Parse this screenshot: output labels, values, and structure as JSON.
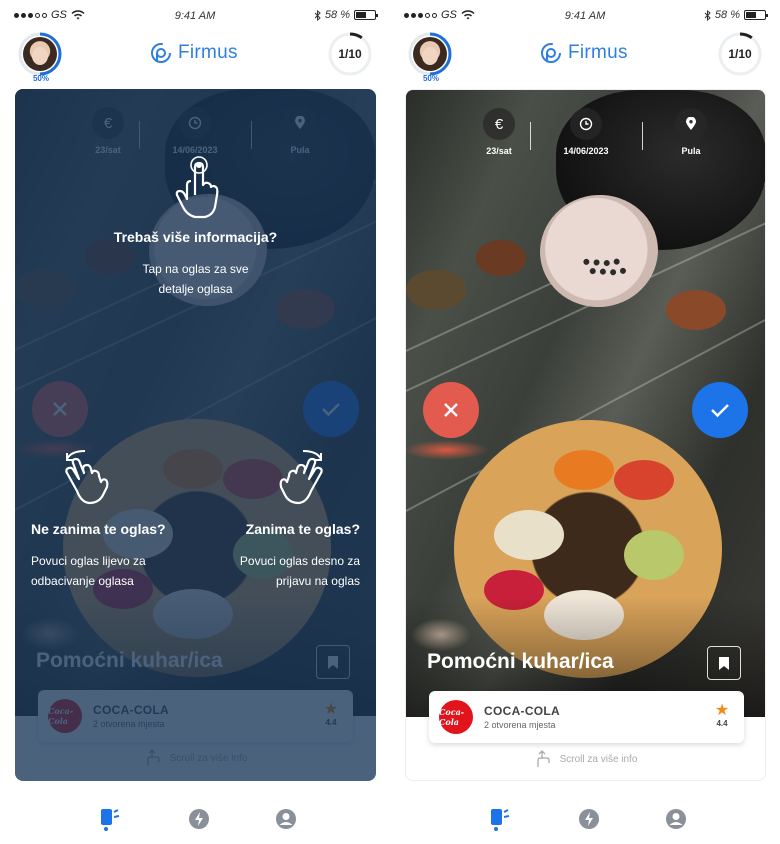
{
  "status_bar": {
    "carrier": "GS",
    "time": "9:41 AM",
    "battery": "58 %",
    "battery_level": 0.58
  },
  "header": {
    "profile_completion": "50%",
    "profile_progress": 0.5,
    "brand": "Firmus",
    "counter": "1/10",
    "counter_progress": 0.1
  },
  "job": {
    "title": "Pomoćni kuhar/ica",
    "meta": [
      {
        "icon": "euro-icon",
        "label": "23/sat"
      },
      {
        "icon": "clock-icon",
        "label": "14/06/2023"
      },
      {
        "icon": "location-pin-icon",
        "label": "Pula"
      }
    ],
    "company": {
      "name": "COCA-COLA",
      "logo_text": "Coca-Cola",
      "openings": "2 otvorena mjesta",
      "rating": "4.4"
    },
    "scroll_hint": "Scroll za više info"
  },
  "tutorial": {
    "tap": {
      "title": "Trebaš više informacija?",
      "line1": "Tap na oglas za sve",
      "line2": "detalje oglasa"
    },
    "left": {
      "title": "Ne zanima te oglas?",
      "line1": "Povuci oglas lijevo za",
      "line2": "odbacivanje oglasa"
    },
    "right": {
      "title": "Zanima te oglas?",
      "line1": "Povuci oglas desno za",
      "line2": "prijavu na oglas"
    }
  },
  "tabbar": [
    {
      "icon": "swipe-cards-icon",
      "active": true
    },
    {
      "icon": "lightning-icon",
      "active": false
    },
    {
      "icon": "profile-icon",
      "active": false
    }
  ],
  "colors": {
    "brand": "#2f7fe0",
    "reject": "#e35b4f",
    "accept": "#1d74e8",
    "star": "#f08a1a",
    "overlay": "#183658"
  }
}
